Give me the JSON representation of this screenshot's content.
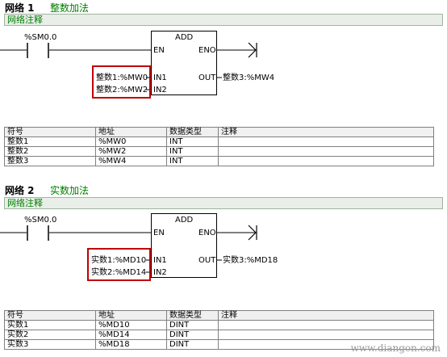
{
  "networks": [
    {
      "label": "网络 1",
      "title": "整数加法",
      "comment": "网络注释",
      "contact": "%SM0.0",
      "block": {
        "name": "ADD",
        "en": "EN",
        "eno": "ENO",
        "in1": "IN1",
        "in2": "IN2",
        "out": "OUT",
        "in1_operand": "整数1:%MW0",
        "in2_operand": "整数2:%MW2",
        "out_operand": "整数3:%MW4"
      },
      "table": {
        "headers": [
          "符号",
          "地址",
          "数据类型",
          "注释"
        ],
        "rows": [
          [
            "整数1",
            "%MW0",
            "INT",
            ""
          ],
          [
            "整数2",
            "%MW2",
            "INT",
            ""
          ],
          [
            "整数3",
            "%MW4",
            "INT",
            ""
          ]
        ]
      }
    },
    {
      "label": "网络 2",
      "title": "实数加法",
      "comment": "网络注释",
      "contact": "%SM0.0",
      "block": {
        "name": "ADD",
        "en": "EN",
        "eno": "ENO",
        "in1": "IN1",
        "in2": "IN2",
        "out": "OUT",
        "in1_operand": "实数1:%MD10",
        "in2_operand": "实数2:%MD14",
        "out_operand": "实数3:%MD18"
      },
      "table": {
        "headers": [
          "符号",
          "地址",
          "数据类型",
          "注释"
        ],
        "rows": [
          [
            "实数1",
            "%MD10",
            "DINT",
            ""
          ],
          [
            "实数2",
            "%MD14",
            "DINT",
            ""
          ],
          [
            "实数3",
            "%MD18",
            "DINT",
            ""
          ]
        ]
      }
    }
  ],
  "watermark": "www.diangon.com",
  "colors": {
    "highlight": "#c00000",
    "title_green": "#008000"
  }
}
